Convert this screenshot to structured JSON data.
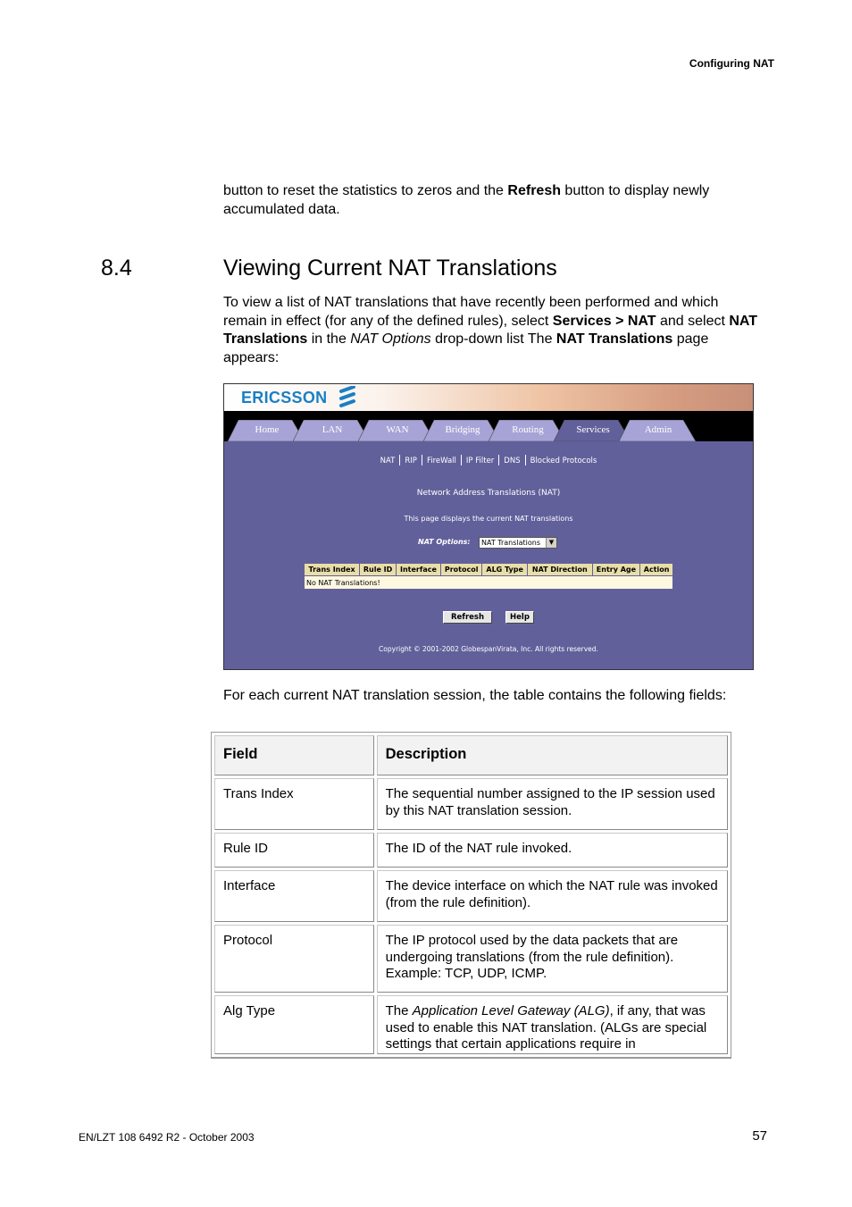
{
  "running_header": "Configuring NAT",
  "intro_paragraph": {
    "part1": "button to reset the statistics to zeros and the ",
    "bold1": "Refresh",
    "part2": " button to display newly accumulated data."
  },
  "section": {
    "number": "8.4",
    "title": "Viewing Current NAT Translations"
  },
  "section_paragraph": {
    "t1": "To view a list of NAT translations that have recently been performed and which remain in effect (for any of the defined rules), select ",
    "b1": "Services > NAT",
    "t2": " and select ",
    "b2": "NAT Translations",
    "t3": " in the ",
    "i1": "NAT Options",
    "t4": " drop-down list The ",
    "b3": "NAT Translations",
    "t5": " page appears:"
  },
  "screenshot": {
    "logo_text": "ERICSSON",
    "tabs": [
      {
        "label": "Home",
        "active": false
      },
      {
        "label": "LAN",
        "active": false
      },
      {
        "label": "WAN",
        "active": false
      },
      {
        "label": "Bridging",
        "active": false
      },
      {
        "label": "Routing",
        "active": false
      },
      {
        "label": "Services",
        "active": true
      },
      {
        "label": "Admin",
        "active": false
      }
    ],
    "nav_links": [
      "NAT",
      "RIP",
      "FireWall",
      "IP Filter",
      "DNS",
      "Blocked Protocols"
    ],
    "title": "Network Address Translations (NAT)",
    "description": "This page displays the current NAT translations",
    "nat_options_label": "NAT Options:",
    "nat_options_value": "NAT Translations",
    "table_headers": [
      "Trans Index",
      "Rule ID",
      "Interface",
      "Protocol",
      "ALG Type",
      "NAT Direction",
      "Entry Age",
      "Action"
    ],
    "empty_message": "No NAT Translations!",
    "refresh_button": "Refresh",
    "help_button": "Help",
    "copyright": "Copyright © 2001-2002 GlobespanVirata, Inc. All rights reserved.",
    "colors": {
      "background": "#62609b",
      "tab_inactive": "#a7a3d6",
      "tab_active": "#62609b",
      "logo": "#1a7fc4",
      "table_header": "#e8dfa8",
      "table_row": "#fdf8e0"
    }
  },
  "fields_intro": "For each current NAT translation session, the table contains the following fields:",
  "field_table": {
    "headers": [
      "Field",
      "Description"
    ],
    "rows": [
      {
        "field": "Trans Index",
        "description": "The sequential number assigned to the IP session used by this NAT translation session."
      },
      {
        "field": "Rule ID",
        "description": "The ID of the NAT rule invoked."
      },
      {
        "field": "Interface",
        "description": "The device interface on which the NAT rule was invoked (from the rule definition)."
      },
      {
        "field": "Protocol",
        "description": "The IP protocol used by the data packets that are undergoing translations (from the rule definition). Example: TCP, UDP, ICMP."
      },
      {
        "field": "Alg Type",
        "desc_pre": "The ",
        "desc_italic": "Application Level Gateway (ALG)",
        "desc_post": ", if any, that was used to enable this NAT translation. (ALGs are special settings that certain applications require in"
      }
    ]
  },
  "footer": {
    "doc_id": "EN/LZT 108 6492 R2 - October 2003",
    "page_number": "57"
  }
}
